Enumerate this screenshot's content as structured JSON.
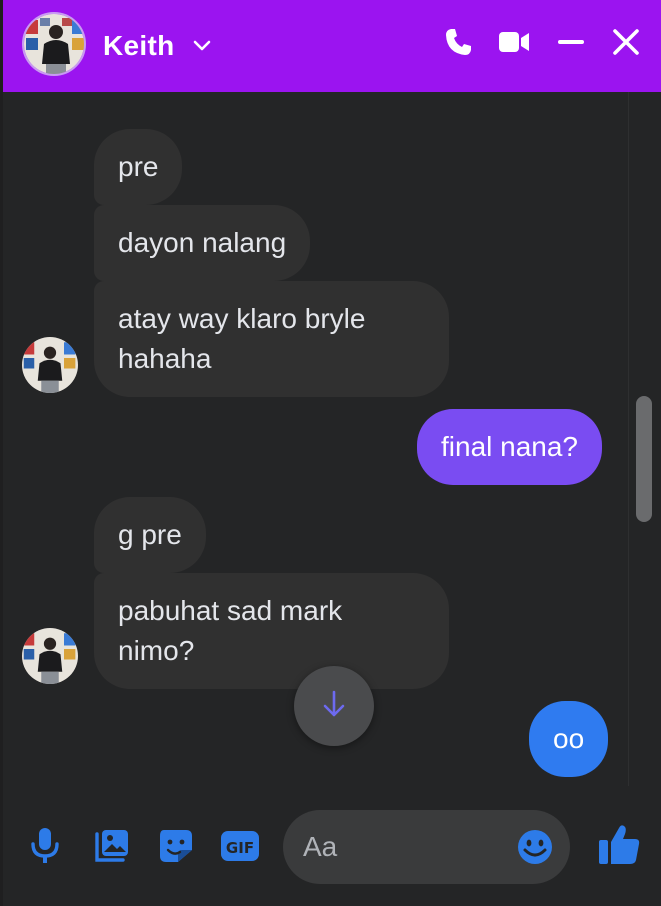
{
  "header": {
    "name": "Keith",
    "accent": "#9b14f0"
  },
  "messages": [
    {
      "id": "m1",
      "direction": "in",
      "text": "pre"
    },
    {
      "id": "m2",
      "direction": "in",
      "text": "dayon nalang"
    },
    {
      "id": "m3",
      "direction": "in",
      "text": "atay way klaro bryle hahaha"
    },
    {
      "id": "m4",
      "direction": "out",
      "text": "final nana?"
    },
    {
      "id": "m5",
      "direction": "in",
      "text": "g pre"
    },
    {
      "id": "m6",
      "direction": "in",
      "text": "pabuhat sad mark nimo?"
    },
    {
      "id": "m7",
      "direction": "out",
      "text": "oo"
    }
  ],
  "composer": {
    "placeholder": "Aa"
  },
  "colors": {
    "outgoing_purple": "#7a4cf2",
    "outgoing_blue": "#2f7bf0",
    "incoming": "#303030",
    "icon_blue": "#2d7be8"
  }
}
